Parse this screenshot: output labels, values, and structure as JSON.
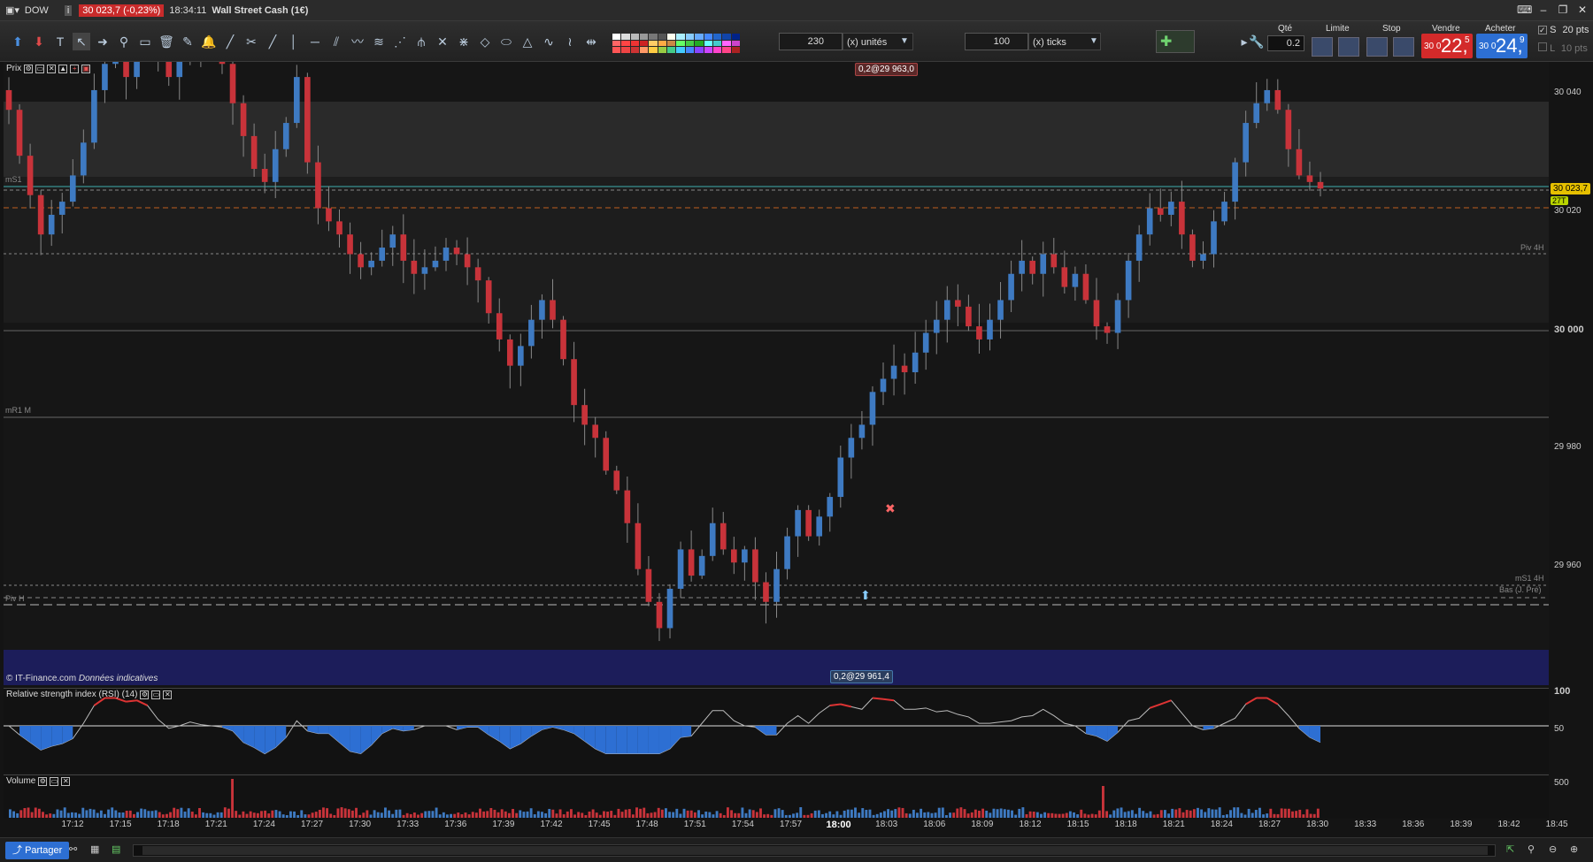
{
  "window": {
    "symbol": "DOW",
    "info_icon": "i",
    "change": "30 023,7 (-0,23%)",
    "time": "18:34:11",
    "instrument": "Wall Street Cash (1€)"
  },
  "toolbar": {
    "units_value": "230",
    "units_label": "(x) unités",
    "ticks_value": "100",
    "ticks_label": "(x) ticks",
    "qty_label": "Qté",
    "qty_value": "0.2",
    "limit_label": "Limite",
    "stop_label": "Stop",
    "sell_label": "Vendre",
    "buy_label": "Acheter",
    "sell_price_small": "30 0",
    "sell_price_big": "22,",
    "sell_price_sup": "5",
    "buy_price_small": "30 0",
    "buy_price_big": "24,",
    "buy_price_sup": "9",
    "s_label": "S",
    "s_value": "20",
    "pts": "pts",
    "l_label": "L",
    "l_value": "10"
  },
  "price_panel": {
    "title": "Prix",
    "copyright": "© IT-Finance.com",
    "disclaimer": "Données indicatives",
    "top_tag": "0,2@29 963,0",
    "bottom_tag": "0,2@29 961,4",
    "current_price_tag": "30 023,7",
    "spread_tag": "27T",
    "line_labels": {
      "ms1": "mS1",
      "piv4h": "Piv 4H",
      "mr1m": "mR1 M",
      "ms14h": "mS1 4H",
      "bas": "Bas (J. Pré)",
      "pivh": "Piv H"
    }
  },
  "price_axis": [
    "30 040",
    "30 020",
    "30 000",
    "29 980",
    "29 960"
  ],
  "rsi_panel": {
    "title": "Relative strength index (RSI) (14)",
    "axis": [
      "100",
      "50"
    ]
  },
  "volume_panel": {
    "title": "Volume",
    "axis": [
      "500"
    ]
  },
  "time_axis": [
    "17:12",
    "17:15",
    "17:18",
    "17:21",
    "17:24",
    "17:27",
    "17:30",
    "17:33",
    "17:36",
    "17:39",
    "17:42",
    "17:45",
    "17:48",
    "17:51",
    "17:54",
    "17:57",
    "18:00",
    "18:03",
    "18:06",
    "18:09",
    "18:12",
    "18:15",
    "18:18",
    "18:21",
    "18:24",
    "18:27",
    "18:30",
    "18:33",
    "18:36",
    "18:39",
    "18:42",
    "18:45"
  ],
  "statusbar": {
    "share_label": "Partager"
  },
  "colors": {
    "up": "#3e7ac2",
    "down": "#c8333a",
    "bg": "#161616",
    "band": "#1c1d5a"
  },
  "chart_data": {
    "type": "candlestick",
    "ylim": [
      29950,
      30045
    ],
    "close_series": [
      30035,
      30028,
      30022,
      30016,
      30019,
      30021,
      30025,
      30030,
      30038,
      30042,
      30044,
      30040,
      30045,
      30046,
      30043,
      30040,
      30044,
      30043,
      30046,
      30046,
      30042,
      30036,
      30031,
      30026,
      30024,
      30029,
      30033,
      30040,
      30027,
      30020,
      30018,
      30016,
      30013,
      30011,
      30012,
      30014,
      30016,
      30012,
      30010,
      30011,
      30012,
      30014,
      30013,
      30011,
      30009,
      30004,
      30000,
      29996,
      29999,
      30003,
      30006,
      30003,
      29997,
      29990,
      29987,
      29985,
      29980,
      29977,
      29972,
      29965,
      29960,
      29956,
      29962,
      29968,
      29964,
      29967,
      29972,
      29968,
      29966,
      29968,
      29963,
      29960,
      29965,
      29970,
      29974,
      29970,
      29973,
      29976,
      29982,
      29985,
      29987,
      29992,
      29994,
      29996,
      29995,
      29998,
      30001,
      30003,
      30006,
      30005,
      30002,
      30000,
      30003,
      30006,
      30010,
      30012,
      30010,
      30013,
      30011,
      30008,
      30010,
      30006,
      30002,
      30001,
      30006,
      30012,
      30016,
      30020,
      30019,
      30021,
      30016,
      30012,
      30013,
      30018,
      30021,
      30027,
      30033,
      30036,
      30038,
      30035,
      30029,
      30025,
      30024,
      30023
    ]
  }
}
